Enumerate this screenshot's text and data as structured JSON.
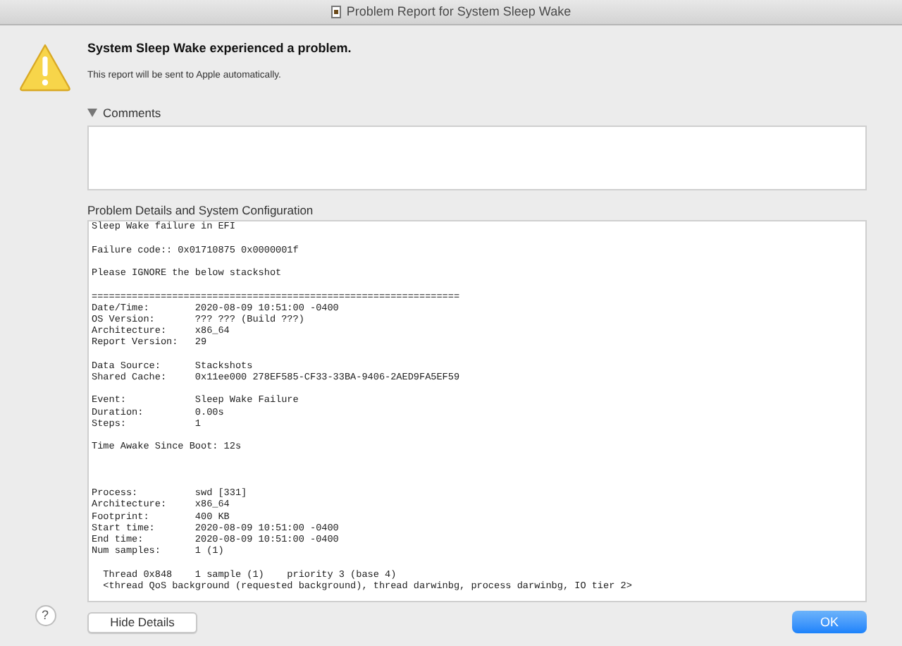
{
  "window": {
    "title": "Problem Report for System Sleep Wake"
  },
  "heading": "System Sleep Wake experienced a problem.",
  "subtext": "This report will be sent to Apple automatically.",
  "comments": {
    "label": "Comments",
    "expanded": true
  },
  "details": {
    "label": "Problem Details and System Configuration",
    "text": "Sleep Wake failure in EFI\n\nFailure code:: 0x01710875 0x0000001f\n\nPlease IGNORE the below stackshot\n\n================================================================\nDate/Time:        2020-08-09 10:51:00 -0400\nOS Version:       ??? ??? (Build ???)\nArchitecture:     x86_64\nReport Version:   29\n\nData Source:      Stackshots\nShared Cache:     0x11ee000 278EF585-CF33-33BA-9406-2AED9FA5EF59\n\nEvent:            Sleep Wake Failure\nDuration:         0.00s\nSteps:            1\n\nTime Awake Since Boot: 12s\n\n\n\nProcess:          swd [331]\nArchitecture:     x86_64\nFootprint:        400 KB\nStart time:       2020-08-09 10:51:00 -0400\nEnd time:         2020-08-09 10:51:00 -0400\nNum samples:      1 (1)\n\n  Thread 0x848    1 sample (1)    priority 3 (base 4)\n  <thread QoS background (requested background), thread darwinbg, process darwinbg, IO tier 2>"
  },
  "help_button": "?",
  "buttons": [
    {
      "label": "Hide Details",
      "kind": "secondary"
    },
    {
      "label": "OK",
      "kind": "primary"
    }
  ]
}
